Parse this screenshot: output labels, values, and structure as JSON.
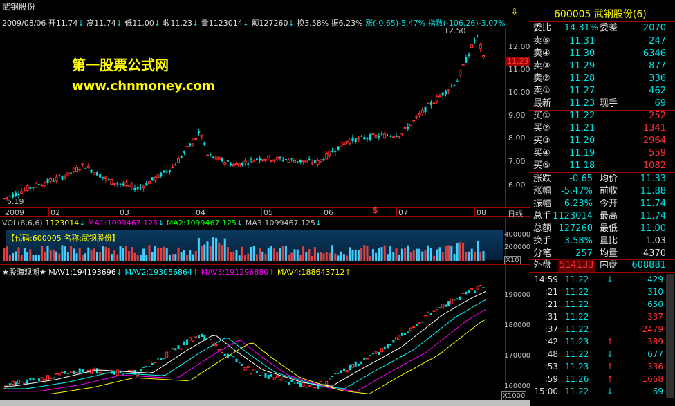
{
  "chart_title": "武钢股份",
  "date_line": {
    "date": "2009/08/06",
    "open": "开11.74",
    "high": "高11.74",
    "low": "低11.00",
    "close": "收11.23",
    "volume": "量1123014",
    "amount": "额127260",
    "turnover": "换3.58%",
    "amplitude": "振6.23%",
    "change": "涨(-0.65)-5.47%",
    "index": "指数(-106.26)-3.07%"
  },
  "watermark": {
    "line1": "第一股票公式网",
    "line2": "www.chnmoney.com"
  },
  "price_axis": {
    "labels": [
      "12.00",
      "11.00",
      "10.00",
      "9.00",
      "8.00",
      "7.00",
      "6.00"
    ],
    "current": "11.23",
    "peak_label": "12.50",
    "low_label": "5.19"
  },
  "time_axis": {
    "labels": [
      "2009",
      "02",
      "03",
      "04",
      "05",
      "06",
      "07",
      "08"
    ],
    "corner": "日线"
  },
  "vol_panel": {
    "header": "VOL(6,6,6)",
    "vol": "1123014",
    "ma1": "MA1:1099467.125",
    "ma2": "MA2:1099467.125",
    "ma3": "MA3:1099467.125",
    "code_label": "【代码:600005 名称:武钢股份】",
    "axis": [
      "400000",
      "200000"
    ],
    "unit": "X10"
  },
  "indicator_panel": {
    "name": "★股海观潮★",
    "mav1": "MAV1:194193696",
    "mav2": "MAV2:193056864",
    "mav3": "MAV3:191296880",
    "mav4": "MAV4:188643712",
    "axis": [
      "190000",
      "180000",
      "170000",
      "160000"
    ],
    "unit": "X1000"
  },
  "colors": {
    "up": "#ff3030",
    "down": "#00e0e0",
    "ma1": "#ffffff",
    "ma2": "#00ffff",
    "ma3": "#ff00ff",
    "ma4": "#ffff00",
    "border": "#a00000"
  },
  "quote": {
    "code_name": "600005 武钢股份(6)",
    "weibi_label": "委比",
    "weibi_value": "-14.31%",
    "weicha_label": "委差",
    "weicha_value": "-2070",
    "asks": [
      {
        "label": "卖⑤",
        "price": "11.31",
        "vol": "247"
      },
      {
        "label": "卖④",
        "price": "11.30",
        "vol": "6346"
      },
      {
        "label": "卖③",
        "price": "11.29",
        "vol": "877"
      },
      {
        "label": "卖②",
        "price": "11.28",
        "vol": "336"
      },
      {
        "label": "卖①",
        "price": "11.27",
        "vol": "462"
      }
    ],
    "latest_label": "最新",
    "latest_value": "11.23",
    "xianshou_label": "现手",
    "xianshou_value": "69",
    "bids": [
      {
        "label": "买①",
        "price": "11.22",
        "vol": "252"
      },
      {
        "label": "买②",
        "price": "11.21",
        "vol": "1341"
      },
      {
        "label": "买③",
        "price": "11.20",
        "vol": "2964"
      },
      {
        "label": "买④",
        "price": "11.19",
        "vol": "559"
      },
      {
        "label": "买⑤",
        "price": "11.18",
        "vol": "1082"
      }
    ],
    "stats": [
      {
        "l1": "涨跌",
        "v1": "-0.65",
        "l2": "均价",
        "v2": "11.33"
      },
      {
        "l1": "涨幅",
        "v1": "-5.47%",
        "l2": "前收",
        "v2": "11.88"
      },
      {
        "l1": "振幅",
        "v1": "6.23%",
        "l2": "今开",
        "v2": "11.74"
      },
      {
        "l1": "总手",
        "v1": "1123014",
        "l2": "最高",
        "v2": "11.74"
      },
      {
        "l1": "总额",
        "v1": "127260",
        "l2": "最低",
        "v2": "11.00"
      },
      {
        "l1": "换手",
        "v1": "3.58%",
        "l2": "量比",
        "v2": "1.03"
      },
      {
        "l1": "分笔",
        "v1": "257",
        "l2": "均量",
        "v2": "4370"
      }
    ],
    "waipan_label": "外盘",
    "waipan_value": "514133",
    "neipan_label": "内盘",
    "neipan_value": "608881",
    "ticks": [
      {
        "time": "14:59",
        "price": "11.22",
        "dir": "↓",
        "vol": "429"
      },
      {
        "time": ":21",
        "price": "11.22",
        "dir": "",
        "vol": "310"
      },
      {
        "time": ":21",
        "price": "11.22",
        "dir": "",
        "vol": "650"
      },
      {
        "time": ":31",
        "price": "11.22",
        "dir": "",
        "vol": "337"
      },
      {
        "time": ":37",
        "price": "11.22",
        "dir": "",
        "vol": "2479"
      },
      {
        "time": ":42",
        "price": "11.23",
        "dir": "↑",
        "vol": "389"
      },
      {
        "time": ":48",
        "price": "11.22",
        "dir": "↓",
        "vol": "677"
      },
      {
        "time": ":53",
        "price": "11.23",
        "dir": "↑",
        "vol": "336"
      },
      {
        "time": ":59",
        "price": "11.26",
        "dir": "↑",
        "vol": "1668"
      },
      {
        "time": "15:00",
        "price": "11.22",
        "dir": "↓",
        "vol": "69"
      }
    ]
  }
}
